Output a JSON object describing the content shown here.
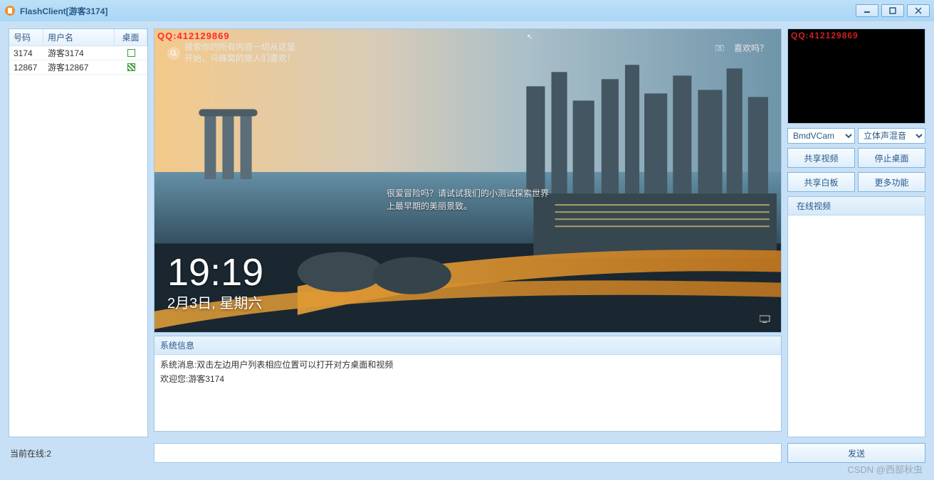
{
  "window": {
    "title": "FlashClient[游客3174]"
  },
  "watermark": "QQ:412129869",
  "overlay_watermark": "CSDN @西部秋虫",
  "user_table": {
    "headers": {
      "id": "号码",
      "name": "用户名",
      "desktop": "桌面"
    },
    "rows": [
      {
        "id": "3174",
        "name": "游客3174",
        "desktop_on": false
      },
      {
        "id": "12867",
        "name": "游客12867",
        "desktop_on": true
      }
    ]
  },
  "lock_screen": {
    "time": "19:19",
    "date": "2月3日, 星期六",
    "search_hint": "搜索你的所有内容一切从这里开始，马蜂窝的旅人们喜欢！",
    "center_caption_line1": "很爱冒险吗？请试试我们的小测试探索世界",
    "center_caption_line2": "上最早期的美丽景致。",
    "top_right_label": "喜欢吗？"
  },
  "info": {
    "header": "系统信息",
    "line1": "系统消息:双击左边用户列表相应位置可以打开对方桌面和视频",
    "line2": "欢迎您:游客3174"
  },
  "right": {
    "camera_select": "BmdVCam",
    "audio_select": "立体声混音",
    "btn_share_video": "共享视频",
    "btn_stop_desktop": "停止桌面",
    "btn_share_whiteboard": "共享白板",
    "btn_more": "更多功能",
    "online_video_header": "在线视频"
  },
  "bottom": {
    "status_label": "当前在线:",
    "status_count": "2",
    "message_placeholder": "",
    "send_label": "发送"
  }
}
